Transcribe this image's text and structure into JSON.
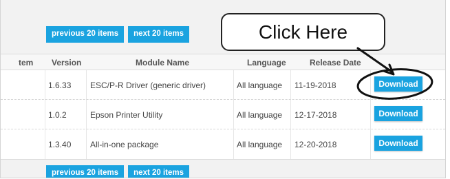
{
  "pagination": {
    "prev_label": "previous 20 items",
    "next_label": "next 20 items"
  },
  "table": {
    "columns": [
      "Item",
      "Version",
      "Module Name",
      "Language",
      "Release Date"
    ],
    "first_column_visible": "tem",
    "rows": [
      {
        "version": "1.6.33",
        "module": "ESC/P-R Driver (generic driver)",
        "language": "All language",
        "date": "11-19-2018",
        "action": "Download"
      },
      {
        "version": "1.0.2",
        "module": "Epson Printer Utility",
        "language": "All language",
        "date": "12-17-2018",
        "action": "Download"
      },
      {
        "version": "1.3.40",
        "module": "All-in-one package",
        "language": "All language",
        "date": "12-20-2018",
        "action": "Download"
      }
    ]
  },
  "annotation": {
    "callout_text": "Click Here"
  },
  "colors": {
    "button_blue": "#1aa3e0",
    "panel_bg": "#f2f2f2"
  }
}
